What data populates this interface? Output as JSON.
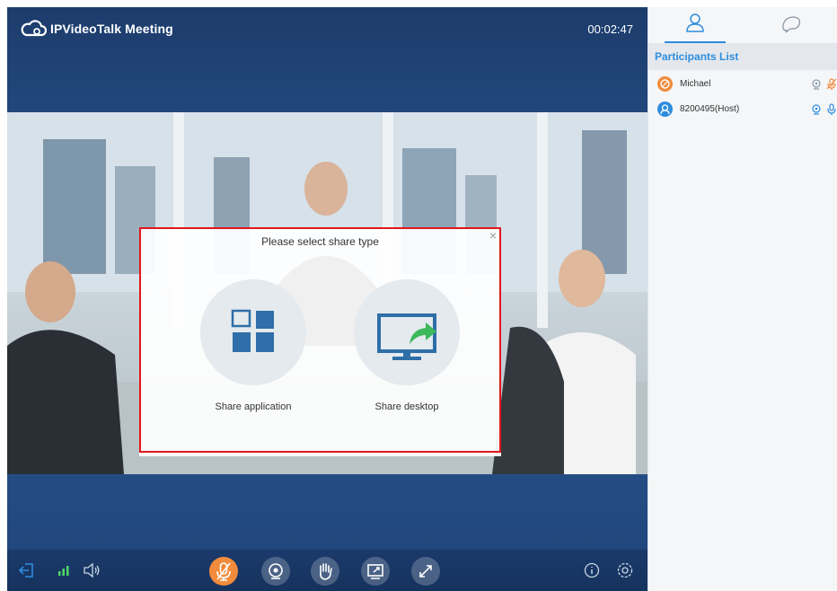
{
  "window": {
    "app_title": "IPVideoTalk Meeting",
    "timer": "00:02:47"
  },
  "share_dialog": {
    "title": "Please select share type",
    "close_glyph": "×",
    "options": [
      {
        "label": "Share application",
        "icon": "windows-grid-icon"
      },
      {
        "label": "Share desktop",
        "icon": "monitor-share-icon"
      }
    ]
  },
  "toolbar": {
    "left_icons": [
      "exit-icon",
      "signal-icon",
      "speaker-icon"
    ],
    "controls": [
      {
        "name": "mute-microphone-button",
        "icon": "microphone-muted-icon",
        "active": true
      },
      {
        "name": "camera-button",
        "icon": "camera-icon"
      },
      {
        "name": "raise-hand-button",
        "icon": "hand-icon"
      },
      {
        "name": "share-screen-button",
        "icon": "share-screen-icon"
      },
      {
        "name": "fullscreen-button",
        "icon": "expand-icon"
      }
    ],
    "right_icons": [
      "info-icon",
      "settings-icon"
    ]
  },
  "sidebar": {
    "tabs": [
      {
        "name": "participants",
        "icon": "person-icon",
        "active": true
      },
      {
        "name": "chat",
        "icon": "chat-bubble-icon",
        "active": false
      }
    ],
    "section_title": "Participants List",
    "participants": [
      {
        "name": "Michael",
        "avatar_color": "#f28b3b",
        "mic_muted": true
      },
      {
        "name": "8200495(Host)",
        "avatar_color": "#2e8ddd",
        "mic_muted": false
      }
    ]
  },
  "colors": {
    "accent": "#2e8ddd",
    "mute_orange": "#f28b3b",
    "highlight_red": "#e2161b",
    "toolbar_blue": "#1b3a6b",
    "signal_green": "#4cd964"
  }
}
